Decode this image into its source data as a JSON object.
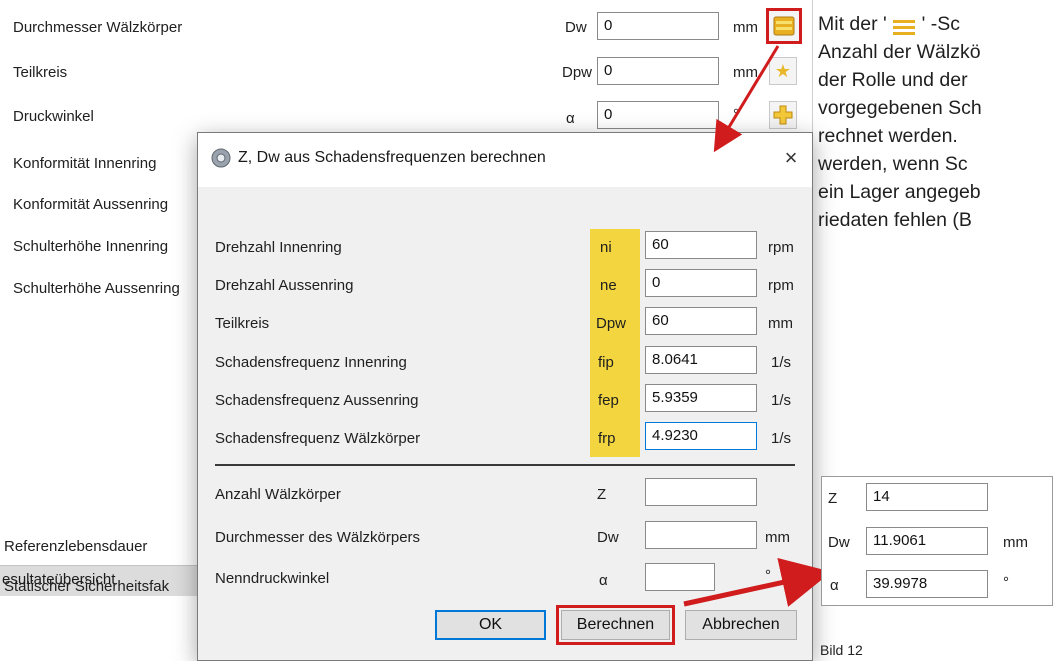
{
  "background_form": {
    "rows": [
      {
        "label": "Durchmesser Wälzkörper",
        "symbol": "Dw",
        "value": "0",
        "unit": "mm"
      },
      {
        "label": "Teilkreis",
        "symbol": "Dpw",
        "value": "0",
        "unit": "mm"
      },
      {
        "label": "Druckwinkel",
        "symbol": "α",
        "value": "0",
        "unit": "°"
      },
      {
        "label": "Konformität Innenring"
      },
      {
        "label": "Konformität Aussenring"
      },
      {
        "label": "Schulterhöhe Innenring"
      },
      {
        "label": "Schulterhöhe Aussenring"
      }
    ],
    "bottom": {
      "resultate": "esultateübersicht",
      "ref": "Referenzlebensdauer",
      "stat": "Statischer Sicherheitsfak"
    }
  },
  "dialog": {
    "title": "Z, Dw aus Schadensfrequenzen berechnen",
    "close": "×",
    "inputs": [
      {
        "label": "Drehzahl Innenring",
        "symbol": "ni",
        "value": "60",
        "unit": "rpm"
      },
      {
        "label": "Drehzahl Aussenring",
        "symbol": "ne",
        "value": "0",
        "unit": "rpm"
      },
      {
        "label": "Teilkreis",
        "symbol": "Dpw",
        "value": "60",
        "unit": "mm"
      },
      {
        "label": "Schadensfrequenz Innenring",
        "symbol": "fip",
        "value": "8.0641",
        "unit": "1/s"
      },
      {
        "label": "Schadensfrequenz Aussenring",
        "symbol": "fep",
        "value": "5.9359",
        "unit": "1/s"
      },
      {
        "label": "Schadensfrequenz Wälzkörper",
        "symbol": "frp",
        "value": "4.9230",
        "unit": "1/s"
      }
    ],
    "outputs": [
      {
        "label": "Anzahl Wälzkörper",
        "symbol": "Z",
        "value": "",
        "unit": ""
      },
      {
        "label": "Durchmesser des Wälzkörpers",
        "symbol": "Dw",
        "value": "",
        "unit": "mm"
      },
      {
        "label": "Nenndruckwinkel",
        "symbol": "α",
        "value": "",
        "unit": "°"
      }
    ],
    "buttons": {
      "ok": "OK",
      "berechnen": "Berechnen",
      "abbrechen": "Abbrechen"
    }
  },
  "side_text": {
    "line1a": "Mit der ' ",
    "line1b": " ' -Sc",
    "line2": "Anzahl der Wälzkö",
    "line3": "der Rolle und der",
    "line4": "vorgegebenen Sch",
    "line5": "rechnet werden. ",
    "line6": "werden, wenn Sc",
    "line7": "ein Lager angegeb",
    "line8": "riedaten fehlen (B"
  },
  "result_panel": {
    "rows": [
      {
        "symbol": "Z",
        "value": "14",
        "unit": ""
      },
      {
        "symbol": "Dw",
        "value": "11.9061",
        "unit": "mm"
      },
      {
        "symbol": "α",
        "value": "39.9978",
        "unit": "°"
      }
    ]
  },
  "caption": "Bild 12",
  "colors": {
    "highlight": "#f3d63f",
    "annotation_red": "#d01c1c",
    "focus_blue": "#0078d7"
  }
}
